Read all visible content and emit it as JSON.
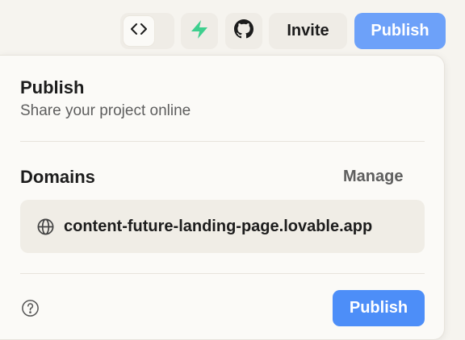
{
  "toolbar": {
    "code_toggle_icon": "code-brackets-icon",
    "bolt_icon": "supabase-bolt-icon",
    "github_icon": "github-icon",
    "invite_label": "Invite",
    "publish_label": "Publish"
  },
  "panel": {
    "title": "Publish",
    "subtitle": "Share your project online",
    "domains_heading": "Domains",
    "manage_label": "Manage",
    "domain": "content-future-landing-page.lovable.app",
    "domain_icon": "globe-icon",
    "help_icon": "question-circle-icon",
    "publish_label": "Publish"
  },
  "colors": {
    "background": "#f6f4ef",
    "panel": "#fbfaf7",
    "publish_button": "#4d8ef8",
    "publish_top_button": "#6da1f9",
    "bolt_green": "#3ecf8e"
  }
}
